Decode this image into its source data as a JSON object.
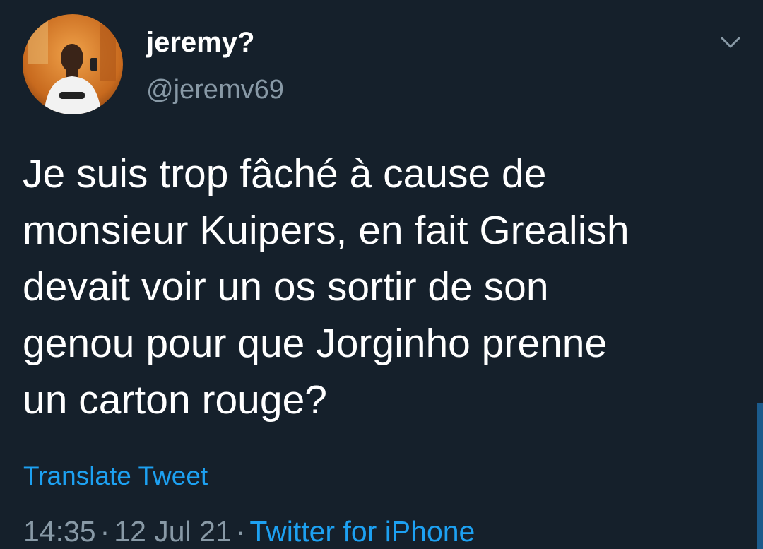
{
  "tweet": {
    "author": {
      "display_name": "jeremy?",
      "handle": "@jeremv69",
      "avatar_icon": "profile-photo"
    },
    "menu_icon": "chevron-down-icon",
    "text_lines": [
      "Je suis trop fâché à cause de",
      "monsieur Kuipers, en fait Grealish",
      "devait voir un os sortir de son",
      "genou pour que Jorginho prenne",
      "un carton rouge?"
    ],
    "translate_label": "Translate Tweet",
    "time": "14:35",
    "date": "12 Jul 21",
    "separator": "·",
    "source": "Twitter for iPhone"
  },
  "colors": {
    "background": "#15202b",
    "primary_text": "#ffffff",
    "secondary_text": "#8899a6",
    "accent": "#1da1f2"
  }
}
